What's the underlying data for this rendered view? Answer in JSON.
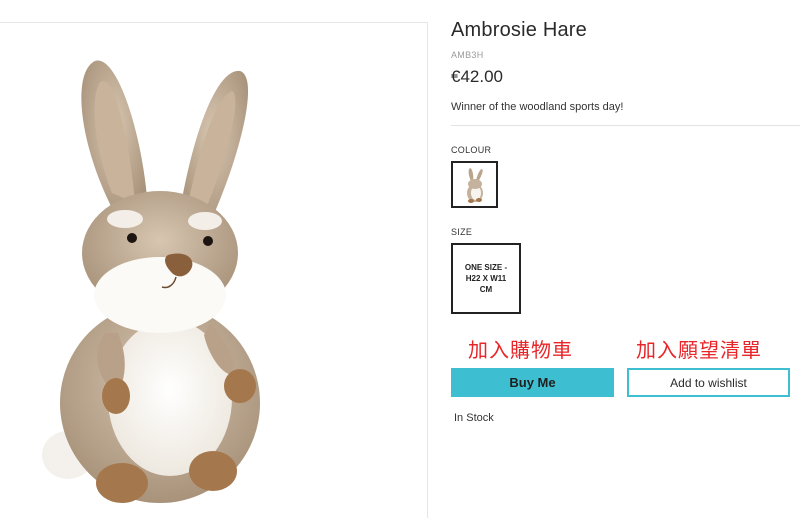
{
  "product": {
    "name": "Ambrosie Hare",
    "sku": "AMB3H",
    "price": "€42.00",
    "tagline": "Winner of the woodland sports day!",
    "stock_status": "In Stock"
  },
  "options": {
    "colour_label": "COLOUR",
    "size_label": "SIZE",
    "size_value": "ONE SIZE - H22 X W11 CM"
  },
  "actions": {
    "buy_label": "Buy Me",
    "wishlist_label": "Add to wishlist",
    "accent_color": "#3dbfd1"
  },
  "annotations": {
    "buy_note": "加入購物車",
    "wishlist_note": "加入願望清單",
    "note_color": "#e8262a"
  }
}
